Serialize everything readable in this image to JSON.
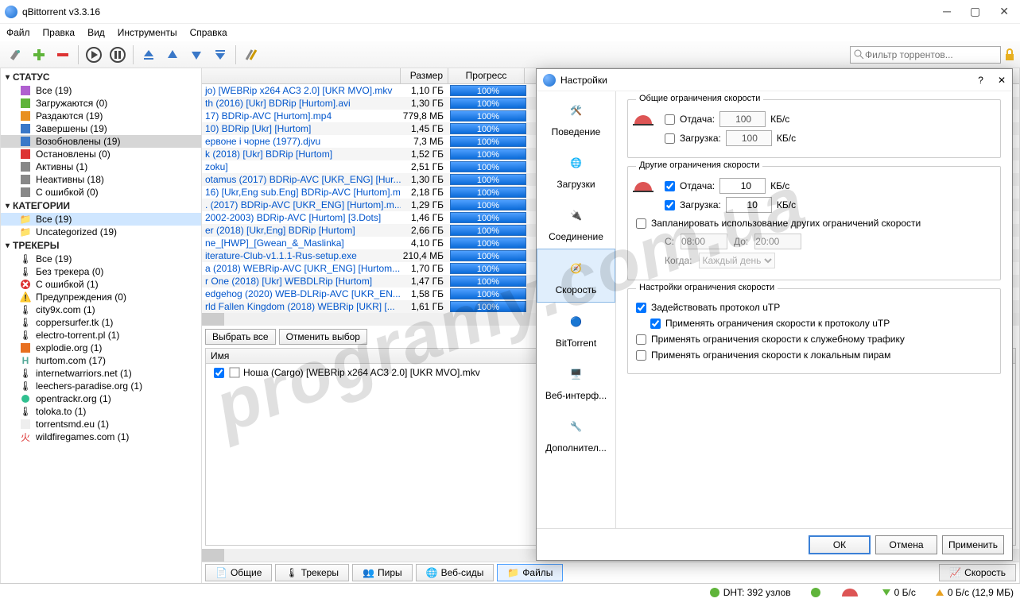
{
  "title": "qBittorrent v3.3.16",
  "menu": {
    "file": "Файл",
    "edit": "Правка",
    "view": "Вид",
    "tools": "Инструменты",
    "help": "Справка"
  },
  "search_placeholder": "Фильтр торрентов...",
  "sidebar": {
    "status_header": "СТАТУС",
    "status": [
      {
        "label": "Все (19)"
      },
      {
        "label": "Загружаются (0)"
      },
      {
        "label": "Раздаются (19)"
      },
      {
        "label": "Завершены (19)"
      },
      {
        "label": "Возобновлены (19)"
      },
      {
        "label": "Остановлены (0)"
      },
      {
        "label": "Активны (1)"
      },
      {
        "label": "Неактивны (18)"
      },
      {
        "label": "С ошибкой (0)"
      }
    ],
    "categories_header": "КАТЕГОРИИ",
    "categories": [
      {
        "label": "Все (19)"
      },
      {
        "label": "Uncategorized (19)"
      }
    ],
    "trackers_header": "ТРЕКЕРЫ",
    "trackers": [
      {
        "label": "Все (19)"
      },
      {
        "label": "Без трекера (0)"
      },
      {
        "label": "С ошибкой (1)"
      },
      {
        "label": "Предупреждения (0)"
      },
      {
        "label": "city9x.com (1)"
      },
      {
        "label": "coppersurfer.tk (1)"
      },
      {
        "label": "electro-torrent.pl (1)"
      },
      {
        "label": "explodie.org (1)"
      },
      {
        "label": "hurtom.com (17)"
      },
      {
        "label": "internetwarriors.net (1)"
      },
      {
        "label": "leechers-paradise.org (1)"
      },
      {
        "label": "opentrackr.org (1)"
      },
      {
        "label": "toloka.to (1)"
      },
      {
        "label": "torrentsmd.eu (1)"
      },
      {
        "label": "wildfiregames.com (1)"
      }
    ]
  },
  "columns": {
    "size": "Размер",
    "progress": "Прогресс"
  },
  "torrents": [
    {
      "name": "jo) [WEBRip x264 AC3 2.0] [UKR MVO].mkv",
      "size": "1,10 ГБ",
      "prog": "100%"
    },
    {
      "name": "th (2016) [Ukr] BDRip [Hurtom].avi",
      "size": "1,30 ГБ",
      "prog": "100%"
    },
    {
      "name": "17) BDRip-AVC [Hurtom].mp4",
      "size": "779,8 МБ",
      "prog": "100%"
    },
    {
      "name": "10) BDRip [Ukr] [Hurtom]",
      "size": "1,45 ГБ",
      "prog": "100%"
    },
    {
      "name": "ервоне і чорне (1977).djvu",
      "size": "7,3 МБ",
      "prog": "100%"
    },
    {
      "name": "k (2018) [Ukr] BDRip [Hurtom]",
      "size": "1,52 ГБ",
      "prog": "100%"
    },
    {
      "name": "zoku]",
      "size": "2,51 ГБ",
      "prog": "100%"
    },
    {
      "name": "otamus (2017) BDRip-AVC [UKR_ENG] [Hur...",
      "size": "1,30 ГБ",
      "prog": "100%"
    },
    {
      "name": "16) [Ukr,Eng sub.Eng] BDRip-AVC [Hurtom].m...",
      "size": "2,18 ГБ",
      "prog": "100%"
    },
    {
      "name": ". (2017) BDRip-AVC [UKR_ENG] [Hurtom].m...",
      "size": "1,29 ГБ",
      "prog": "100%"
    },
    {
      "name": "2002-2003) BDRip-AVC [Hurtom] [3.Dots]",
      "size": "1,46 ГБ",
      "prog": "100%"
    },
    {
      "name": "er (2018) [Ukr,Eng] BDRip [Hurtom]",
      "size": "2,66 ГБ",
      "prog": "100%"
    },
    {
      "name": "ne_[HWP]_[Gwean_&_Maslinka]",
      "size": "4,10 ГБ",
      "prog": "100%"
    },
    {
      "name": "iterature-Club-v1.1.1-Rus-setup.exe",
      "size": "210,4 МБ",
      "prog": "100%"
    },
    {
      "name": "а (2018) WEBRip-AVC [UKR_ENG] [Hurtom...",
      "size": "1,70 ГБ",
      "prog": "100%"
    },
    {
      "name": "r One (2018) [Ukr] WEBDLRip [Hurtom]",
      "size": "1,47 ГБ",
      "prog": "100%"
    },
    {
      "name": "edgehog (2020) WEB-DLRip-AVC [UKR_EN...",
      "size": "1,58 ГБ",
      "prog": "100%"
    },
    {
      "name": "rld Fallen Kingdom (2018) WEBRip [UKR] [...",
      "size": "1,61 ГБ",
      "prog": "100%"
    }
  ],
  "select_all": "Выбрать все",
  "deselect": "Отменить выбор",
  "file_header": "Имя",
  "file_name": "Ноша (Cargo) [WEBRip x264 AC3 2.0] [UKR MVO].mkv",
  "tabs": {
    "general": "Общие",
    "trackers": "Трекеры",
    "peers": "Пиры",
    "webseeds": "Веб-сиды",
    "files": "Файлы",
    "speed": "Скорость"
  },
  "status": {
    "dht": "DHT: 392 узлов",
    "down": "0 Б/с",
    "up": "0 Б/с (12,9 МБ)"
  },
  "dialog": {
    "title": "Настройки",
    "nav": {
      "behaviour": "Поведение",
      "downloads": "Загрузки",
      "connection": "Соединение",
      "speed": "Скорость",
      "bittorrent": "BitTorrent",
      "webui": "Веб-интерф...",
      "advanced": "Дополнител..."
    },
    "group1_title": "Общие ограничения скорости",
    "upload_label": "Отдача:",
    "download_label": "Загрузка:",
    "unit": "КБ/с",
    "global_up": "100",
    "global_down": "100",
    "group2_title": "Другие ограничения скорости",
    "alt_up": "10",
    "alt_down": "10",
    "schedule": "Запланировать использование других ограничений скорости",
    "from_label": "С:",
    "from_val": "08:00",
    "to_label": "До:",
    "to_val": "20:00",
    "when_label": "Когда:",
    "when_val": "Каждый день",
    "group3_title": "Настройки ограничения скорости",
    "g3_1": "Задействовать протокол uTP",
    "g3_2": "Применять ограничения скорости к протоколу uTP",
    "g3_3": "Применять ограничения скорости к служебному трафику",
    "g3_4": "Применять ограничения скорости к локальным пирам",
    "ok": "ОК",
    "cancel": "Отмена",
    "apply": "Применить"
  },
  "watermark": "programy.com.ua"
}
